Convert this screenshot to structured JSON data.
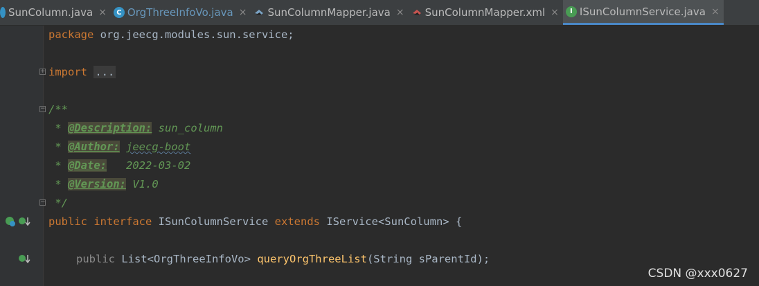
{
  "tabs": [
    {
      "label": "SunColumn.java",
      "icon": "class-icon",
      "active": false
    },
    {
      "label": "OrgThreeInfoVo.java",
      "icon": "class-icon",
      "active": false
    },
    {
      "label": "SunColumnMapper.java",
      "icon": "mapper-icon",
      "active": false
    },
    {
      "label": "SunColumnMapper.xml",
      "icon": "xml-icon",
      "active": false
    },
    {
      "label": "ISunColumnService.java",
      "icon": "interface-icon",
      "active": true
    }
  ],
  "close_glyph": "×",
  "code": {
    "package_kw": "package",
    "package_name": " org.jeecg.modules.sun.service;",
    "import_kw": "import",
    "import_folded": "...",
    "doc_open": "/**",
    "doc_star": " * ",
    "desc_tag": "@Description:",
    "desc_val": " sun_column",
    "author_tag": "@Author:",
    "author_val": "jeecg-boot",
    "date_tag": "@Date:",
    "date_val": "   2022-03-02",
    "version_tag": "@Version:",
    "version_val": " V1.0",
    "doc_close": " */",
    "public_kw": "public",
    "interface_kw": "interface",
    "interface_name": " ISunColumnService ",
    "extends_kw": "extends",
    "extends_type": " IService<SunColumn> {",
    "method_public": "public",
    "method_return": " List<OrgThreeInfoVo> ",
    "method_name": "queryOrgThreeList",
    "method_params": "(String sParentId);"
  },
  "watermark": "CSDN @xxx0627"
}
